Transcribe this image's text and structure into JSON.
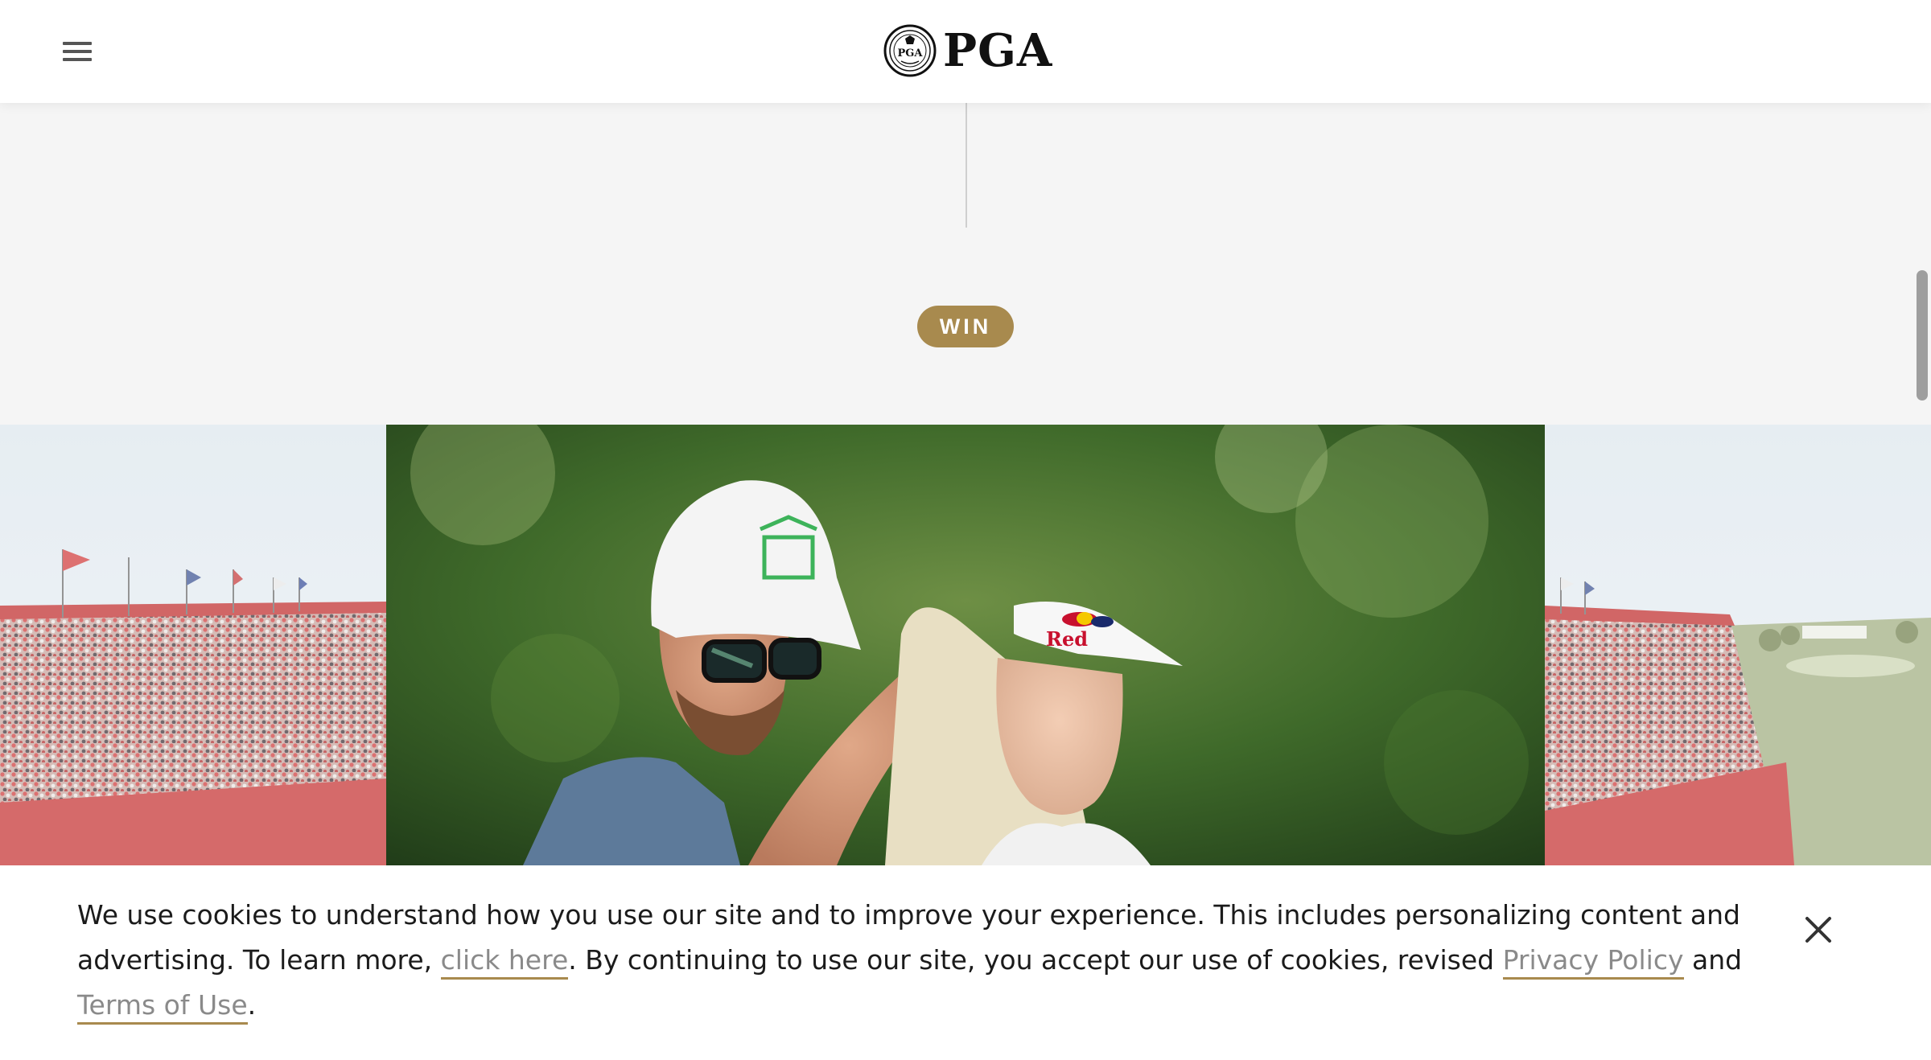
{
  "header": {
    "logo_text": "PGA",
    "logo_seal_text": "PGA",
    "menu_icon": "hamburger-menu-icon"
  },
  "badge": {
    "label": "WIN"
  },
  "cookie_banner": {
    "text_before_link": "We use cookies to understand how you use our site and to improve your experience. This includes personalizing content and advertising. To learn more, ",
    "click_here_label": "click here",
    "text_middle": ". By continuing to use our site, you accept our use of cookies, revised ",
    "privacy_label": "Privacy Policy",
    "and_text": " and ",
    "terms_label": "Terms of Use",
    "period": ".",
    "close_icon": "close-icon"
  },
  "colors": {
    "accent_gold": "#a88a4e",
    "page_background": "#f5f5f5",
    "header_background": "#ffffff",
    "text": "#1b1b1b"
  }
}
